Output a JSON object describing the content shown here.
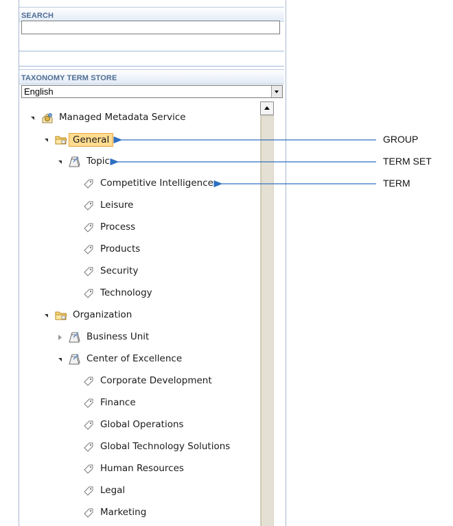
{
  "search": {
    "title": "SEARCH",
    "value": ""
  },
  "store": {
    "title": "TAXONOMY TERM STORE",
    "language": "English"
  },
  "tree": [
    {
      "label": "Managed Metadata Service",
      "type": "service",
      "level": 0,
      "expander": "open"
    },
    {
      "label": "General",
      "type": "group",
      "level": 1,
      "expander": "open",
      "selected": true
    },
    {
      "label": "Topic",
      "type": "termset",
      "level": 2,
      "expander": "open"
    },
    {
      "label": "Competitive Intelligence",
      "type": "term",
      "level": 3
    },
    {
      "label": "Leisure",
      "type": "term",
      "level": 3
    },
    {
      "label": "Process",
      "type": "term",
      "level": 3
    },
    {
      "label": "Products",
      "type": "term",
      "level": 3
    },
    {
      "label": "Security",
      "type": "term",
      "level": 3
    },
    {
      "label": "Technology",
      "type": "term",
      "level": 3
    },
    {
      "label": "Organization",
      "type": "group",
      "level": 1,
      "expander": "open"
    },
    {
      "label": "Business Unit",
      "type": "termset",
      "level": 2,
      "expander": "closed"
    },
    {
      "label": "Center of Excellence",
      "type": "termset",
      "level": 2,
      "expander": "open"
    },
    {
      "label": "Corporate Development",
      "type": "term",
      "level": 3
    },
    {
      "label": "Finance",
      "type": "term",
      "level": 3
    },
    {
      "label": "Global Operations",
      "type": "term",
      "level": 3
    },
    {
      "label": "Global Technology Solutions",
      "type": "term",
      "level": 3
    },
    {
      "label": "Human Resources",
      "type": "term",
      "level": 3
    },
    {
      "label": "Legal",
      "type": "term",
      "level": 3
    },
    {
      "label": "Marketing",
      "type": "term",
      "level": 3
    }
  ],
  "annotations": [
    {
      "label": "GROUP",
      "target": "General"
    },
    {
      "label": "TERM SET",
      "target": "Topic"
    },
    {
      "label": "TERM",
      "target": "Competitive Intelligence"
    }
  ],
  "colors": {
    "accent_blue": "#3a78c6",
    "header_text": "#4f6d92",
    "selection": "#ffdc8f",
    "arrow": "#2e6fc0"
  }
}
